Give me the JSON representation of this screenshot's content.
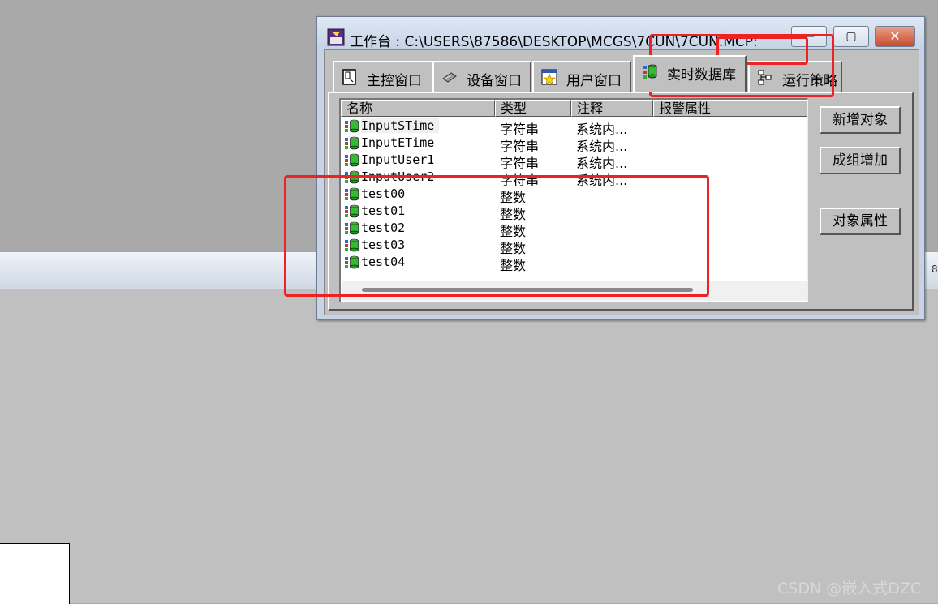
{
  "window": {
    "title": "工作台 : C:\\USERS\\87586\\DESKTOP\\MCGS\\7CUN\\7CUN.MCP:",
    "min_glyph": "—",
    "max_glyph": "▢",
    "close_glyph": "✕"
  },
  "tabs": [
    {
      "label": "主控窗口",
      "icon": "main-window-icon",
      "active": false
    },
    {
      "label": "设备窗口",
      "icon": "device-window-icon",
      "active": false
    },
    {
      "label": "用户窗口",
      "icon": "user-window-icon",
      "active": false
    },
    {
      "label": "实时数据库",
      "icon": "realtime-db-icon",
      "active": true
    },
    {
      "label": "运行策略",
      "icon": "run-strategy-icon",
      "active": false
    }
  ],
  "list": {
    "columns": [
      "名称",
      "类型",
      "注释",
      "报警属性"
    ],
    "rows": [
      {
        "name": "InputSTime",
        "type": "字符串",
        "note": "系统内...",
        "alarm": ""
      },
      {
        "name": "InputETime",
        "type": "字符串",
        "note": "系统内...",
        "alarm": ""
      },
      {
        "name": "InputUser1",
        "type": "字符串",
        "note": "系统内...",
        "alarm": ""
      },
      {
        "name": "InputUser2",
        "type": "字符串",
        "note": "系统内...",
        "alarm": ""
      },
      {
        "name": "test00",
        "type": "整数",
        "note": "",
        "alarm": ""
      },
      {
        "name": "test01",
        "type": "整数",
        "note": "",
        "alarm": ""
      },
      {
        "name": "test02",
        "type": "整数",
        "note": "",
        "alarm": ""
      },
      {
        "name": "test03",
        "type": "整数",
        "note": "",
        "alarm": ""
      },
      {
        "name": "test04",
        "type": "整数",
        "note": "",
        "alarm": ""
      }
    ]
  },
  "buttons": {
    "add_object": "新增对象",
    "group_add": "成组增加",
    "object_props": "对象属性"
  },
  "background": {
    "edge_glyph": "8"
  },
  "watermark": "CSDN @嵌入式DZC",
  "colors": {
    "annotation_red": "#ee2222",
    "client_gray": "#c0c0c0",
    "close_red": "#c84a2c"
  }
}
